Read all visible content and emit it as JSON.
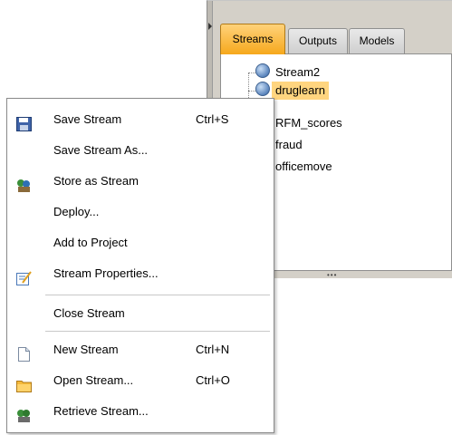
{
  "manager": {
    "tabs": [
      {
        "label": "Streams",
        "active": true
      },
      {
        "label": "Outputs",
        "active": false
      },
      {
        "label": "Models",
        "active": false
      }
    ],
    "streams": [
      {
        "label": "Stream2",
        "selected": false
      },
      {
        "label": "druglearn",
        "selected": true
      },
      {
        "label": "RFM_scores",
        "selected": false
      },
      {
        "label": "fraud",
        "selected": false
      },
      {
        "label": "officemove",
        "selected": false
      }
    ],
    "splitter_grip": "•••",
    "icon_names": {
      "stream": "stream-globe-icon",
      "grip": "panel-grip-arrow-icon"
    }
  },
  "context_menu": {
    "items": [
      {
        "label": "Save Stream",
        "shortcut": "Ctrl+S",
        "icon": "save-disk-icon"
      },
      {
        "label": "Save Stream As...",
        "shortcut": "",
        "icon": ""
      },
      {
        "label": "Store as Stream",
        "shortcut": "",
        "icon": "store-stream-icon"
      },
      {
        "label": "Deploy...",
        "shortcut": "",
        "icon": ""
      },
      {
        "label": "Add to Project",
        "shortcut": "",
        "icon": ""
      },
      {
        "label": "Stream Properties...",
        "shortcut": "",
        "icon": "properties-icon"
      },
      {
        "label": "Close Stream",
        "shortcut": "",
        "icon": ""
      },
      {
        "label": "New Stream",
        "shortcut": "Ctrl+N",
        "icon": "new-document-icon"
      },
      {
        "label": "Open Stream...",
        "shortcut": "Ctrl+O",
        "icon": "open-folder-icon"
      },
      {
        "label": "Retrieve Stream...",
        "shortcut": "",
        "icon": "retrieve-stream-icon"
      }
    ]
  },
  "colors": {
    "active_tab": "#f6a81c",
    "selection": "#ffd57f",
    "panel_bg": "#d4d0c8"
  }
}
